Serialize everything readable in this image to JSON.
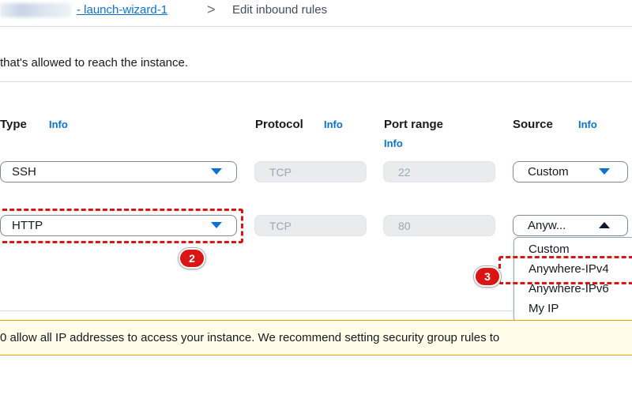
{
  "breadcrumb": {
    "link": "- launch-wizard-1",
    "separator": ">",
    "current": "Edit inbound rules"
  },
  "description": "that's allowed to reach the instance.",
  "columns": {
    "type": "Type",
    "protocol": "Protocol",
    "port_range": "Port range",
    "source": "Source",
    "info": "Info"
  },
  "rows": [
    {
      "type": "SSH",
      "protocol": "TCP",
      "port": "22",
      "source": "Custom"
    },
    {
      "type": "HTTP",
      "protocol": "TCP",
      "port": "80",
      "source": "Anyw..."
    }
  ],
  "source_dropdown": {
    "expanded": true,
    "options": [
      "Custom",
      "Anywhere-IPv4",
      "Anywhere-IPv6",
      "My IP"
    ]
  },
  "annotations": {
    "step2": "2",
    "step3": "3"
  },
  "warning": "0 allow all IP addresses to access your instance. We recommend setting security group rules to",
  "colors": {
    "link": "#0972d3",
    "highlight": "#d91515",
    "warning_bg": "#fffce9",
    "disabled_bg": "#e9ebed"
  },
  "icons": [
    "chevron-right-icon",
    "caret-down-icon",
    "caret-up-icon"
  ]
}
